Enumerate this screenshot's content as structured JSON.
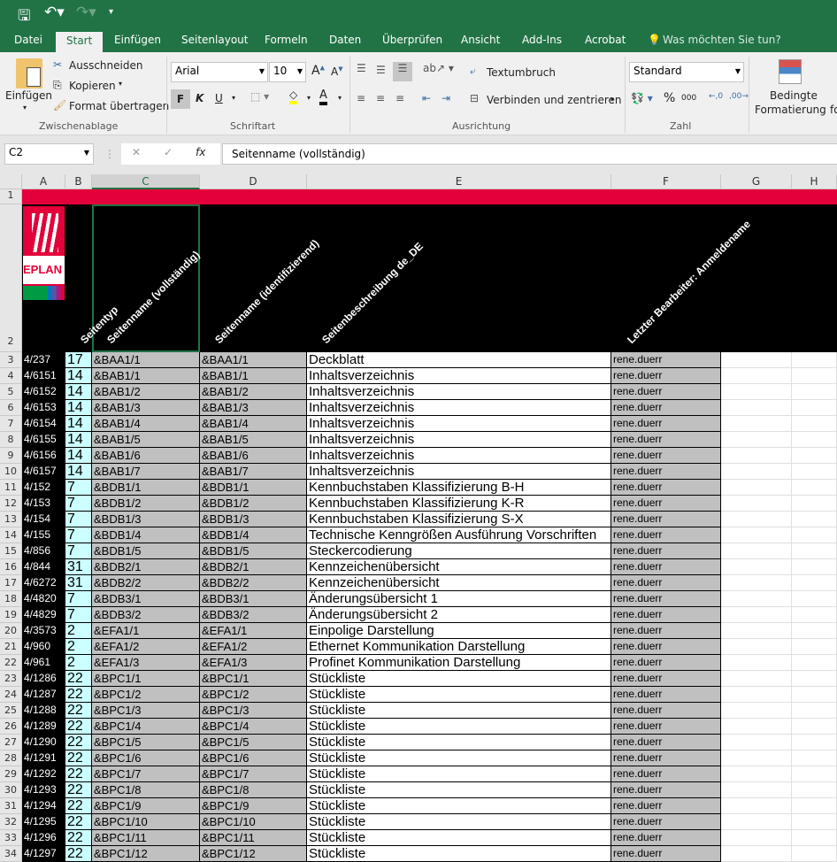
{
  "quick_access": {
    "save": "save-icon",
    "undo": "undo-icon",
    "redo": "redo-icon",
    "customize": "customize-icon"
  },
  "tabs": [
    "Datei",
    "Start",
    "Einfügen",
    "Seitenlayout",
    "Formeln",
    "Daten",
    "Überprüfen",
    "Ansicht",
    "Add-Ins",
    "Acrobat"
  ],
  "tell_me": "Was möchten Sie tun?",
  "ribbon": {
    "paste": "Einfügen",
    "cut": "Ausschneiden",
    "copy": "Kopieren",
    "format_painter": "Format übertragen",
    "clipboard_group": "Zwischenablage",
    "font_name": "Arial",
    "font_size": "10",
    "bold": "F",
    "italic": "K",
    "underline": "U",
    "font_group": "Schriftart",
    "wrap_text": "Textumbruch",
    "merge_center": "Verbinden und zentrieren",
    "alignment_group": "Ausrichtung",
    "number_format": "Standard",
    "percent": "%",
    "thousands": "000",
    "number_group": "Zahl",
    "conditional_1": "Bedingte",
    "conditional_2": "Formatierung",
    "conditional_more": "fo"
  },
  "formula_bar": {
    "name_box": "C2",
    "fx": "fx",
    "formula": "Seitenname (vollständig)"
  },
  "columns": [
    "A",
    "B",
    "C",
    "D",
    "E",
    "F",
    "G",
    "H"
  ],
  "headers": [
    "Seitentyp",
    "Seitenname (vollständig)",
    "Seitenname (identifizierend)",
    "Seitenbeschreibung de_DE",
    "Letzter Bearbeiter: Anmeldename"
  ],
  "logo": "EPLAN",
  "rows": [
    [
      "3",
      "4/237",
      "17",
      "&BAA1/1",
      "&BAA1/1",
      "Deckblatt",
      "rene.duerr"
    ],
    [
      "4",
      "4/6151",
      "14",
      "&BAB1/1",
      "&BAB1/1",
      "Inhaltsverzeichnis",
      "rene.duerr"
    ],
    [
      "5",
      "4/6152",
      "14",
      "&BAB1/2",
      "&BAB1/2",
      "Inhaltsverzeichnis",
      "rene.duerr"
    ],
    [
      "6",
      "4/6153",
      "14",
      "&BAB1/3",
      "&BAB1/3",
      "Inhaltsverzeichnis",
      "rene.duerr"
    ],
    [
      "7",
      "4/6154",
      "14",
      "&BAB1/4",
      "&BAB1/4",
      "Inhaltsverzeichnis",
      "rene.duerr"
    ],
    [
      "8",
      "4/6155",
      "14",
      "&BAB1/5",
      "&BAB1/5",
      "Inhaltsverzeichnis",
      "rene.duerr"
    ],
    [
      "9",
      "4/6156",
      "14",
      "&BAB1/6",
      "&BAB1/6",
      "Inhaltsverzeichnis",
      "rene.duerr"
    ],
    [
      "10",
      "4/6157",
      "14",
      "&BAB1/7",
      "&BAB1/7",
      "Inhaltsverzeichnis",
      "rene.duerr"
    ],
    [
      "11",
      "4/152",
      "7",
      "&BDB1/1",
      "&BDB1/1",
      "Kennbuchstaben Klassifizierung B-H",
      "rene.duerr"
    ],
    [
      "12",
      "4/153",
      "7",
      "&BDB1/2",
      "&BDB1/2",
      "Kennbuchstaben Klassifizierung K-R",
      "rene.duerr"
    ],
    [
      "13",
      "4/154",
      "7",
      "&BDB1/3",
      "&BDB1/3",
      "Kennbuchstaben Klassifizierung S-X",
      "rene.duerr"
    ],
    [
      "14",
      "4/155",
      "7",
      "&BDB1/4",
      "&BDB1/4",
      "Technische Kenngrößen Ausführung Vorschriften",
      "rene.duerr"
    ],
    [
      "15",
      "4/856",
      "7",
      "&BDB1/5",
      "&BDB1/5",
      "Steckercodierung",
      "rene.duerr"
    ],
    [
      "16",
      "4/844",
      "31",
      "&BDB2/1",
      "&BDB2/1",
      "Kennzeichenübersicht",
      "rene.duerr"
    ],
    [
      "17",
      "4/6272",
      "31",
      "&BDB2/2",
      "&BDB2/2",
      "Kennzeichenübersicht",
      "rene.duerr"
    ],
    [
      "18",
      "4/4820",
      "7",
      "&BDB3/1",
      "&BDB3/1",
      "Änderungsübersicht 1",
      "rene.duerr"
    ],
    [
      "19",
      "4/4829",
      "7",
      "&BDB3/2",
      "&BDB3/2",
      "Änderungsübersicht 2",
      "rene.duerr"
    ],
    [
      "20",
      "4/3573",
      "2",
      "&EFA1/1",
      "&EFA1/1",
      "Einpolige Darstellung",
      "rene.duerr"
    ],
    [
      "21",
      "4/960",
      "2",
      "&EFA1/2",
      "&EFA1/2",
      "Ethernet Kommunikation Darstellung",
      "rene.duerr"
    ],
    [
      "22",
      "4/961",
      "2",
      "&EFA1/3",
      "&EFA1/3",
      "Profinet Kommunikation Darstellung",
      "rene.duerr"
    ],
    [
      "23",
      "4/1286",
      "22",
      "&BPC1/1",
      "&BPC1/1",
      "Stückliste",
      "rene.duerr"
    ],
    [
      "24",
      "4/1287",
      "22",
      "&BPC1/2",
      "&BPC1/2",
      "Stückliste",
      "rene.duerr"
    ],
    [
      "25",
      "4/1288",
      "22",
      "&BPC1/3",
      "&BPC1/3",
      "Stückliste",
      "rene.duerr"
    ],
    [
      "26",
      "4/1289",
      "22",
      "&BPC1/4",
      "&BPC1/4",
      "Stückliste",
      "rene.duerr"
    ],
    [
      "27",
      "4/1290",
      "22",
      "&BPC1/5",
      "&BPC1/5",
      "Stückliste",
      "rene.duerr"
    ],
    [
      "28",
      "4/1291",
      "22",
      "&BPC1/6",
      "&BPC1/6",
      "Stückliste",
      "rene.duerr"
    ],
    [
      "29",
      "4/1292",
      "22",
      "&BPC1/7",
      "&BPC1/7",
      "Stückliste",
      "rene.duerr"
    ],
    [
      "30",
      "4/1293",
      "22",
      "&BPC1/8",
      "&BPC1/8",
      "Stückliste",
      "rene.duerr"
    ],
    [
      "31",
      "4/1294",
      "22",
      "&BPC1/9",
      "&BPC1/9",
      "Stückliste",
      "rene.duerr"
    ],
    [
      "32",
      "4/1295",
      "22",
      "&BPC1/10",
      "&BPC1/10",
      "Stückliste",
      "rene.duerr"
    ],
    [
      "33",
      "4/1296",
      "22",
      "&BPC1/11",
      "&BPC1/11",
      "Stückliste",
      "rene.duerr"
    ],
    [
      "34",
      "4/1297",
      "22",
      "&BPC1/12",
      "&BPC1/12",
      "Stückliste",
      "rene.duerr"
    ]
  ],
  "colors": {
    "excel_green": "#217346",
    "header_red": "#e4003a",
    "col_b": "#ccffff",
    "gray_cells": "#c0c0c0"
  }
}
